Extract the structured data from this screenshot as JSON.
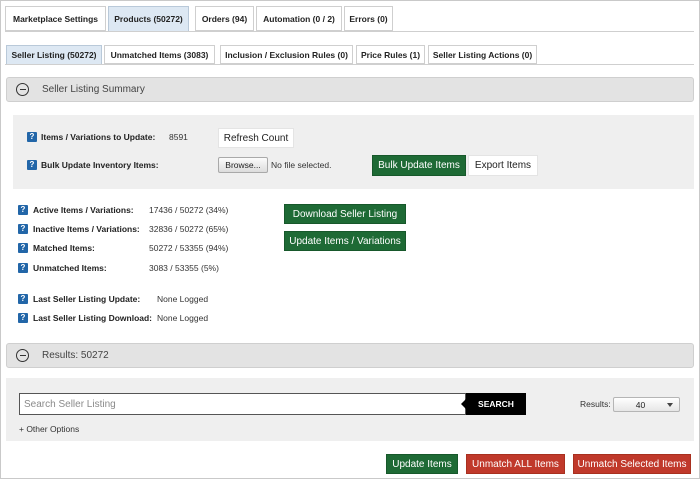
{
  "top_tabs": [
    {
      "label": "Marketplace Settings",
      "active": false
    },
    {
      "label": "Products (50272)",
      "active": true
    },
    {
      "label": "Orders (94)",
      "active": false
    },
    {
      "label": "Automation (0 / 2)",
      "active": false
    },
    {
      "label": "Errors (0)",
      "active": false
    }
  ],
  "sub_tabs": [
    {
      "label": "Seller Listing (50272)",
      "active": true
    },
    {
      "label": "Unmatched Items (3083)",
      "active": false
    },
    {
      "label": "Inclusion / Exclusion Rules (0)",
      "active": false
    },
    {
      "label": "Price Rules (1)",
      "active": false
    },
    {
      "label": "Seller Listing Actions (0)",
      "active": false
    }
  ],
  "summary": {
    "title": "Seller Listing Summary",
    "help_glyph": "?",
    "items_to_update_label": "Items / Variations to Update:",
    "items_to_update_value": "8591",
    "refresh_label": "Refresh Count",
    "bulk_label": "Bulk Update Inventory Items:",
    "browse_label": "Browse...",
    "no_file_text": "No file selected.",
    "bulk_update_label": "Bulk Update Items",
    "export_label": "Export Items",
    "stats": [
      {
        "label": "Active Items / Variations:",
        "value": "17436 / 50272 (34%)"
      },
      {
        "label": "Inactive Items / Variations:",
        "value": "32836 / 50272 (65%)"
      },
      {
        "label": "Matched Items:",
        "value": "50272 / 53355 (94%)"
      },
      {
        "label": "Unmatched Items:",
        "value": "3083 / 53355 (5%)"
      }
    ],
    "download_label": "Download Seller Listing",
    "update_variations_label": "Update Items / Variations",
    "last_update_label": "Last Seller Listing Update:",
    "last_update_value": "None Logged",
    "last_download_label": "Last Seller Listing Download:",
    "last_download_value": "None Logged"
  },
  "results": {
    "title": "Results: 50272",
    "search_placeholder": "Search Seller Listing",
    "search_button": "SEARCH",
    "results_label": "Results:",
    "results_value": "40",
    "other_options": "+ Other Options"
  },
  "footer": {
    "update_items": "Update Items",
    "unmatch_all": "Unmatch ALL Items",
    "unmatch_selected": "Unmatch Selected Items"
  },
  "colors": {
    "green": "#1e6a35",
    "red": "#c0392b",
    "help_blue": "#2266a8",
    "active_tab": "#dde8f3"
  }
}
